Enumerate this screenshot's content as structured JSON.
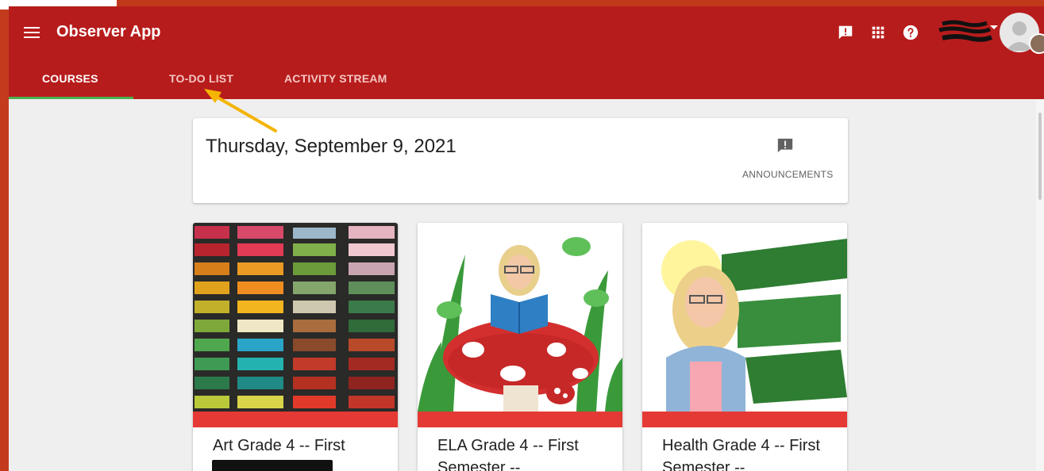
{
  "app": {
    "title": "Observer App"
  },
  "header_icons": [
    "announcement-icon",
    "apps-grid-icon",
    "help-icon"
  ],
  "tabs": [
    {
      "label": "COURSES",
      "active": true
    },
    {
      "label": "TO-DO LIST",
      "active": false
    },
    {
      "label": "ACTIVITY STREAM",
      "active": false
    }
  ],
  "date_card": {
    "date": "Thursday, September 9, 2021",
    "announcements_label": "ANNOUNCEMENTS"
  },
  "courses": [
    {
      "name": "Art Grade 4 -- First",
      "image": "pastels-image",
      "band_color": "#e53935"
    },
    {
      "name": "ELA Grade 4 -- First Semester --",
      "image": "bitmoji-reading-image",
      "band_color": "#e53935"
    },
    {
      "name": "Health Grade 4 -- First Semester --",
      "image": "be-kind-to-your-mind-image",
      "band_color": "#e53935"
    }
  ],
  "colors": {
    "header": "#b71c1c",
    "tab_indicator": "#4caf50",
    "annotation_arrow": "#f4b400",
    "page_bg": "#efefef"
  }
}
